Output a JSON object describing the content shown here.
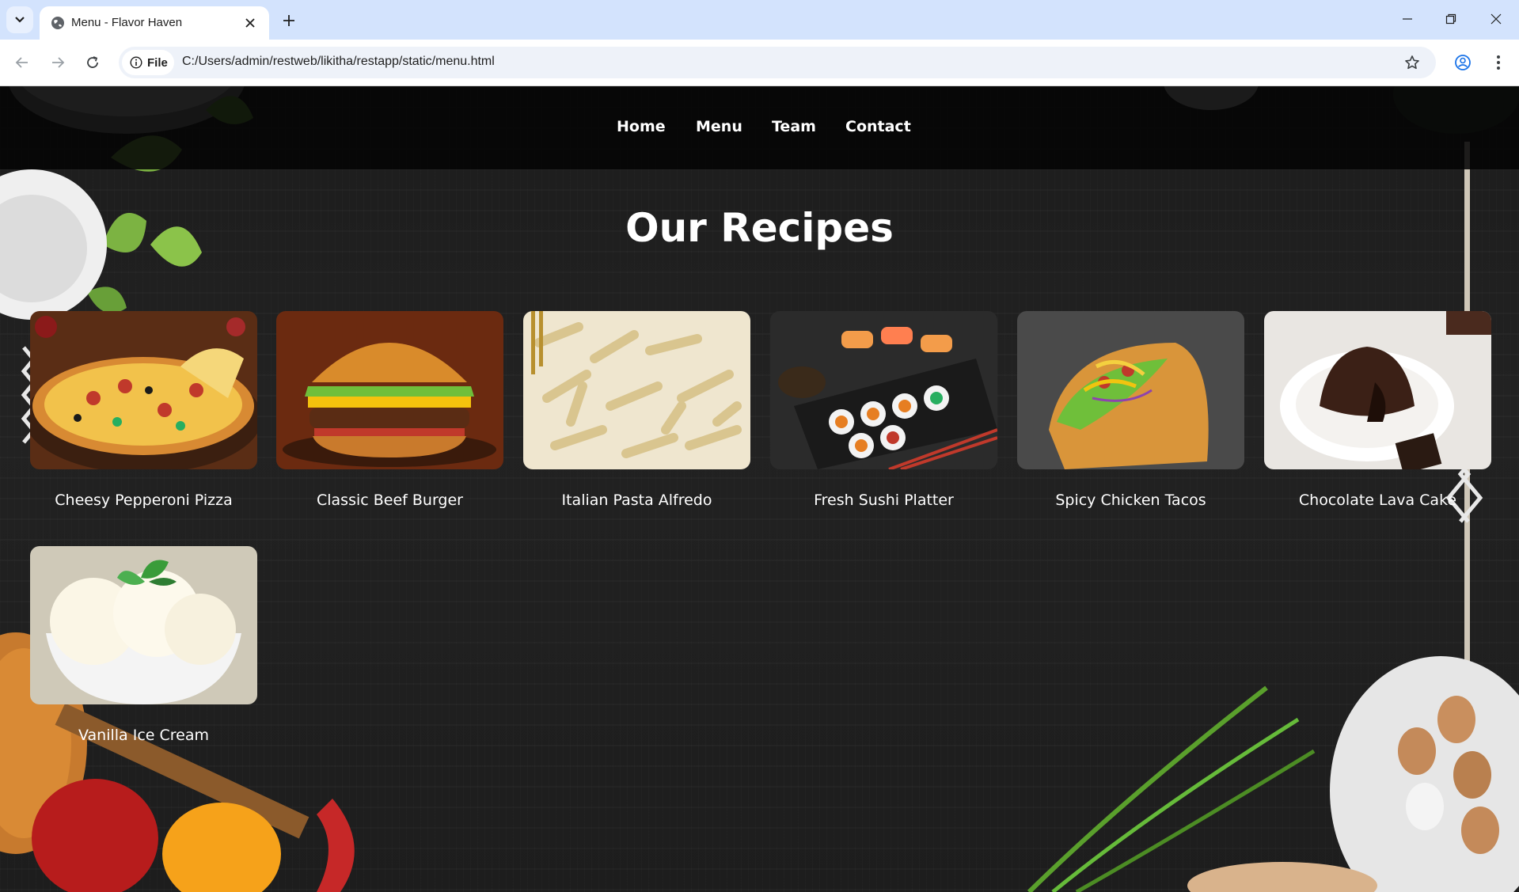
{
  "browser": {
    "tab_title": "Menu - Flavor Haven",
    "chip_label": "File",
    "url": "C:/Users/admin/restweb/likitha/restapp/static/menu.html"
  },
  "site": {
    "nav": [
      "Home",
      "Menu",
      "Team",
      "Contact"
    ],
    "heading": "Our Recipes",
    "recipes": [
      {
        "name": "Cheesy Pepperoni Pizza",
        "image": "pizza"
      },
      {
        "name": "Classic Beef Burger",
        "image": "burger"
      },
      {
        "name": "Italian Pasta Alfredo",
        "image": "pasta"
      },
      {
        "name": "Fresh Sushi Platter",
        "image": "sushi"
      },
      {
        "name": "Spicy Chicken Tacos",
        "image": "taco"
      },
      {
        "name": "Chocolate Lava Cake",
        "image": "lava-cake"
      },
      {
        "name": "Vanilla Ice Cream",
        "image": "ice-cream"
      }
    ]
  },
  "colors": {
    "tabbar": "#d3e3fd",
    "page_background": "#1e1e1e",
    "nav_background": "#050505",
    "text": "#ffffff"
  }
}
